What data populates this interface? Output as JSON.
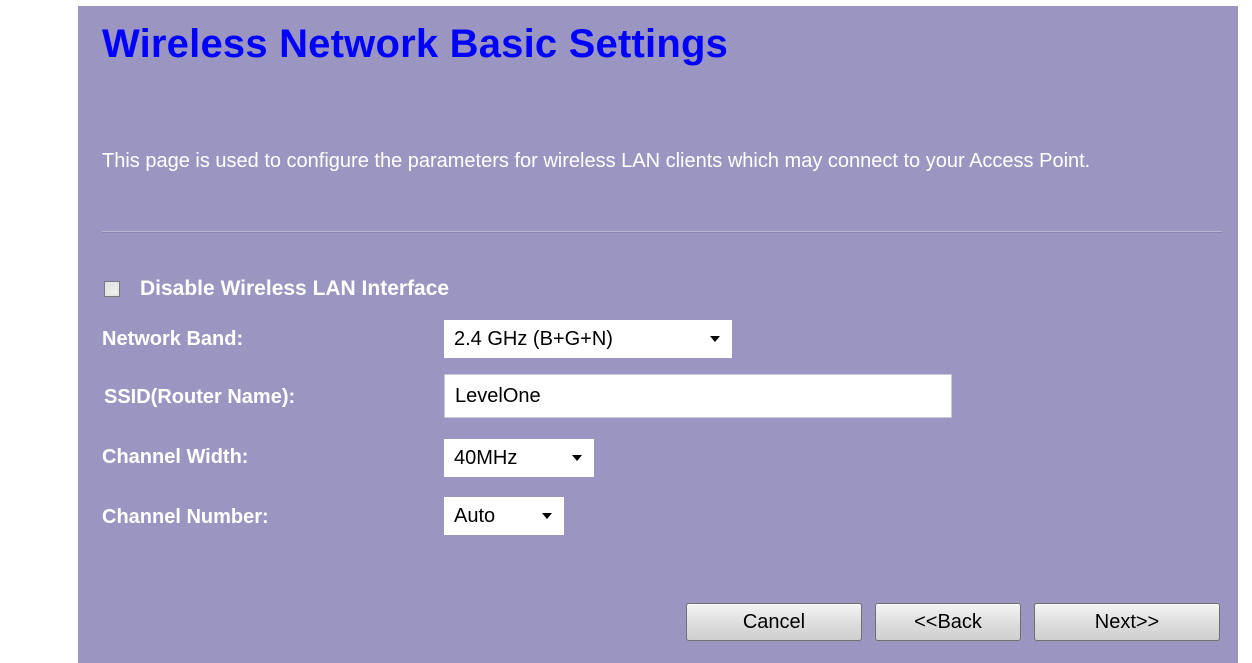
{
  "page": {
    "title": "Wireless Network Basic Settings",
    "description": "This page is used to configure the parameters for wireless LAN clients which may connect to your Access Point."
  },
  "form": {
    "disable_wireless": {
      "label": "Disable Wireless LAN Interface",
      "checked": false
    },
    "network_band": {
      "label": "Network Band:",
      "value": "2.4 GHz (B+G+N)"
    },
    "ssid": {
      "label": "SSID(Router Name):",
      "value": "LevelOne"
    },
    "channel_width": {
      "label": "Channel Width:",
      "value": "40MHz"
    },
    "channel_number": {
      "label": "Channel Number:",
      "value": "Auto"
    }
  },
  "buttons": {
    "cancel": "Cancel",
    "back": "<<Back",
    "next": "Next>>"
  },
  "colors": {
    "panel_background": "#9b96c1",
    "title": "#0000ff",
    "text": "#ffffff"
  },
  "icons": {
    "dropdown": "chevron-down-icon"
  }
}
